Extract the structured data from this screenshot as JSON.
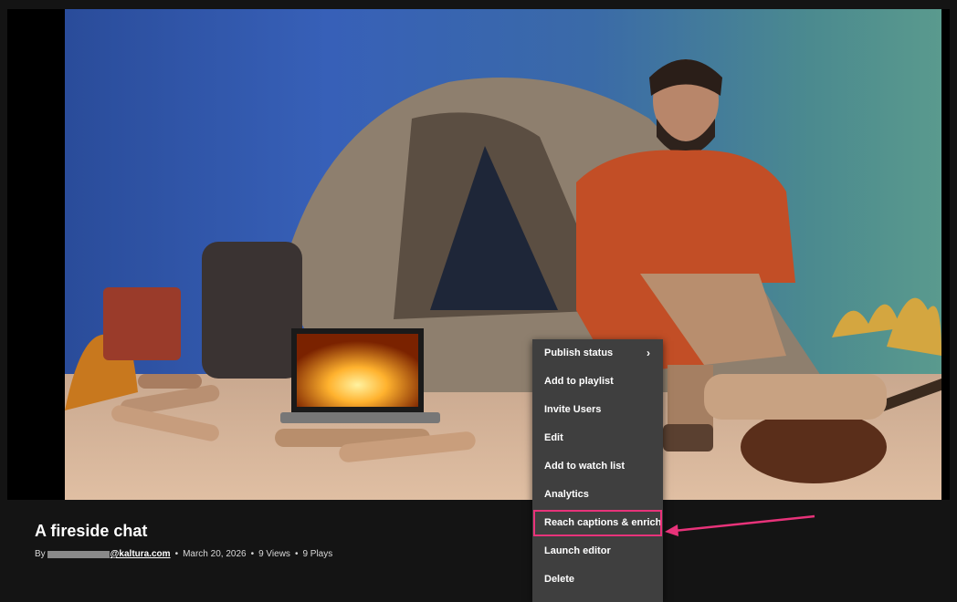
{
  "entry": {
    "title": "A fireside chat",
    "by_label": "By",
    "owner_email_domain": "@kaltura.com",
    "date": "March 20, 2026",
    "separator": "•",
    "views": "9 Views",
    "plays": "9 Plays"
  },
  "context_menu": {
    "items": [
      {
        "label": "Publish status",
        "has_submenu": true,
        "chevron": "›"
      },
      {
        "label": "Add to playlist"
      },
      {
        "label": "Invite Users"
      },
      {
        "label": "Edit"
      },
      {
        "label": "Add to watch list"
      },
      {
        "label": "Analytics"
      },
      {
        "label": "Reach captions & enrich",
        "highlighted": true
      },
      {
        "label": "Launch editor"
      },
      {
        "label": "Delete"
      }
    ]
  },
  "colors": {
    "annotation": "#e8337a",
    "menu_bg": "#3f3f3f",
    "page_bg": "#141414"
  }
}
